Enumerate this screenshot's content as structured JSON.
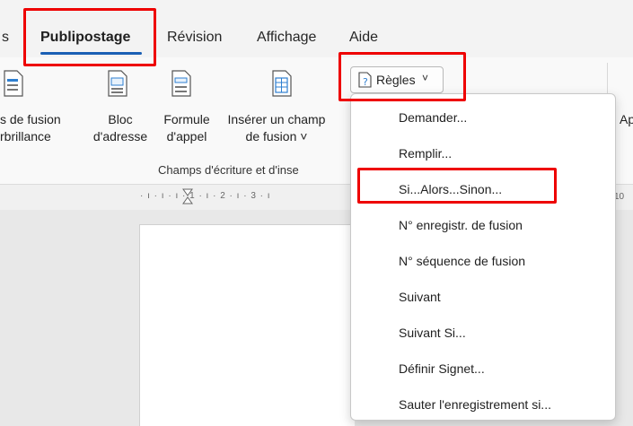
{
  "tabs": [
    {
      "label": "s",
      "active": false
    },
    {
      "label": "Publipostage",
      "active": true
    },
    {
      "label": "Révision",
      "active": false
    },
    {
      "label": "Affichage",
      "active": false
    },
    {
      "label": "Aide",
      "active": false
    }
  ],
  "ribbon": {
    "buttons": [
      {
        "line1": "s de fusion",
        "line2": "rbrillance"
      },
      {
        "line1": "Bloc",
        "line2": "d'adresse"
      },
      {
        "line1": "Formule",
        "line2": "d'appel"
      },
      {
        "line1": "Insérer un champ",
        "line2": "de fusion ˅"
      }
    ],
    "group_label": "Champs d'écriture et d'inse",
    "regles_label": "Règles",
    "right_partial_line1": "Ap"
  },
  "ruler": {
    "text": "· ı · ı · ı · 1 · ı · 2 · ı · 3 · ı",
    "right": "10"
  },
  "menu": {
    "items": [
      "Demander...",
      "Remplir...",
      "Si...Alors...Sinon...",
      "N° enregistr. de fusion",
      "N° séquence de fusion",
      "Suivant",
      "Suivant Si...",
      "Définir Signet...",
      "Sauter l'enregistrement si..."
    ]
  },
  "colors": {
    "highlight": "#ee0000",
    "accent": "#1a5fb4"
  }
}
